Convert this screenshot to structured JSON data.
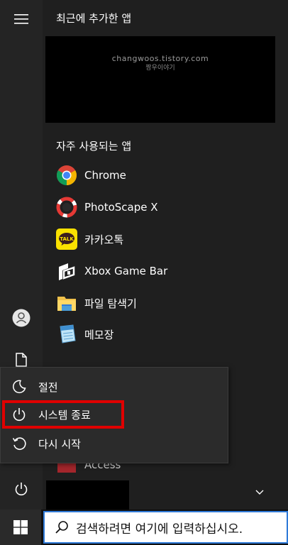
{
  "rail": {
    "menu_icon": "hamburger-icon",
    "user_icon": "user-icon",
    "documents_icon": "document-icon",
    "power_icon": "power-icon"
  },
  "recent": {
    "title": "최근에 추가한 앱",
    "watermark_url": "changwoos.tistory.com",
    "watermark_name": "짱우이야기"
  },
  "frequent": {
    "title": "자주 사용되는 앱",
    "apps": [
      {
        "label": "Chrome",
        "icon": "chrome-icon"
      },
      {
        "label": "PhotoScape X",
        "icon": "photoscape-icon"
      },
      {
        "label": "카카오톡",
        "icon": "kakaotalk-icon"
      },
      {
        "label": "Xbox Game Bar",
        "icon": "xbox-game-bar-icon"
      },
      {
        "label": "파일 탐색기",
        "icon": "file-explorer-icon"
      },
      {
        "label": "메모장",
        "icon": "notepad-icon"
      }
    ],
    "partial_app": "Access"
  },
  "power_menu": {
    "items": [
      {
        "label": "절전",
        "icon": "moon-icon"
      },
      {
        "label": "시스템 종료",
        "icon": "power-icon"
      },
      {
        "label": "다시 시작",
        "icon": "restart-icon"
      }
    ],
    "highlight_color": "#e00000"
  },
  "taskbar": {
    "start_icon": "windows-logo-icon",
    "search_icon": "search-icon",
    "search_placeholder": "검색하려면 여기에 입력하십시오."
  },
  "colors": {
    "background": "#1f1f1f",
    "flyout": "#2b2b2b",
    "search_border": "#2f7ad8",
    "kakao_yellow": "#fae100"
  }
}
